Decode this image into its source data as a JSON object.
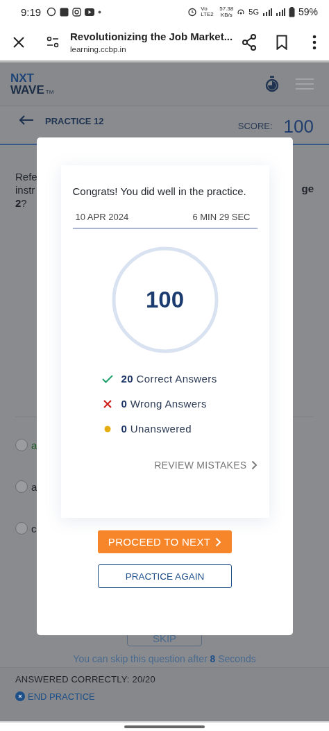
{
  "status_bar": {
    "time": "9:19",
    "network_label": "Vo LTE2",
    "speed": "57.38",
    "speed_unit": "KB/s",
    "network": "5G",
    "battery": "59%"
  },
  "browser_bar": {
    "title": "Revolutionizing the Job Market...",
    "url": "learning.ccbp.in"
  },
  "header": {
    "logo_top": "NXT",
    "logo_bottom": "WAVE",
    "logo_mark": "TM"
  },
  "practice_bar": {
    "title": "PRACTICE 12",
    "score_label": "SCORE:",
    "score": "100"
  },
  "question": {
    "left_lines": [
      "Refe",
      "instr"
    ],
    "right_fragment": "ge",
    "number": "2",
    "mark": "?"
  },
  "options": [
    {
      "letter": "a",
      "correct": true,
      "selected": false
    },
    {
      "letter": "a",
      "correct": false,
      "selected": false
    },
    {
      "letter": "c",
      "correct": false,
      "selected": false
    }
  ],
  "skip": {
    "label": "SKIP",
    "note_before": "You can skip this question after",
    "seconds": "8",
    "note_after": "Seconds"
  },
  "footer": {
    "answered": "ANSWERED CORRECTLY: 20/20",
    "end": "END PRACTICE"
  },
  "result": {
    "message": "Congrats! You did well in the practice.",
    "date": "10 APR 2024",
    "duration": "6 MIN 29 SEC",
    "score": "100",
    "stats": [
      {
        "kind": "correct",
        "count": "20",
        "label": "Correct Answers"
      },
      {
        "kind": "wrong",
        "count": "0",
        "label": "Wrong Answers"
      },
      {
        "kind": "unanswered",
        "count": "0",
        "label": "Unanswered"
      }
    ],
    "review": "REVIEW MISTAKES",
    "proceed": "PROCEED TO NEXT",
    "again": "PRACTICE AGAIN"
  }
}
